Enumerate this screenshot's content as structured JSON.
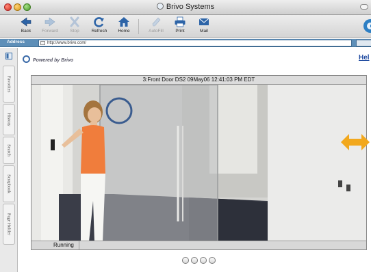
{
  "window": {
    "title": "Brivo Systems"
  },
  "toolbar": {
    "buttons": [
      {
        "id": "back",
        "label": "Back",
        "icon": "back-arrow-icon",
        "enabled": true
      },
      {
        "id": "forward",
        "label": "Forward",
        "icon": "forward-arrow-icon",
        "enabled": false
      },
      {
        "id": "stop",
        "label": "Stop",
        "icon": "stop-x-icon",
        "enabled": false
      },
      {
        "id": "refresh",
        "label": "Refresh",
        "icon": "refresh-icon",
        "enabled": true
      },
      {
        "id": "home",
        "label": "Home",
        "icon": "home-icon",
        "enabled": true
      },
      {
        "id": "autofill",
        "label": "AutoFill",
        "icon": "autofill-pencil-icon",
        "enabled": false
      },
      {
        "id": "print",
        "label": "Print",
        "icon": "printer-icon",
        "enabled": true
      },
      {
        "id": "mail",
        "label": "Mail",
        "icon": "mail-icon",
        "enabled": true
      }
    ]
  },
  "address": {
    "label": "Address",
    "url": "http://www.brivo.com/"
  },
  "explorer_tabs": [
    "Favorites",
    "History",
    "Search",
    "Scrapbook",
    "Page Holder"
  ],
  "page": {
    "powered_by": "Powered by Brivo",
    "help_link": "Hel"
  },
  "camera": {
    "header": "3:Front Door DS2 09May06 12:41:03 PM EDT",
    "status": "Running"
  },
  "colors": {
    "address_bar": "#5e8fb8",
    "link": "#1f4aa0",
    "callout_arrow": "#f2a81d"
  }
}
